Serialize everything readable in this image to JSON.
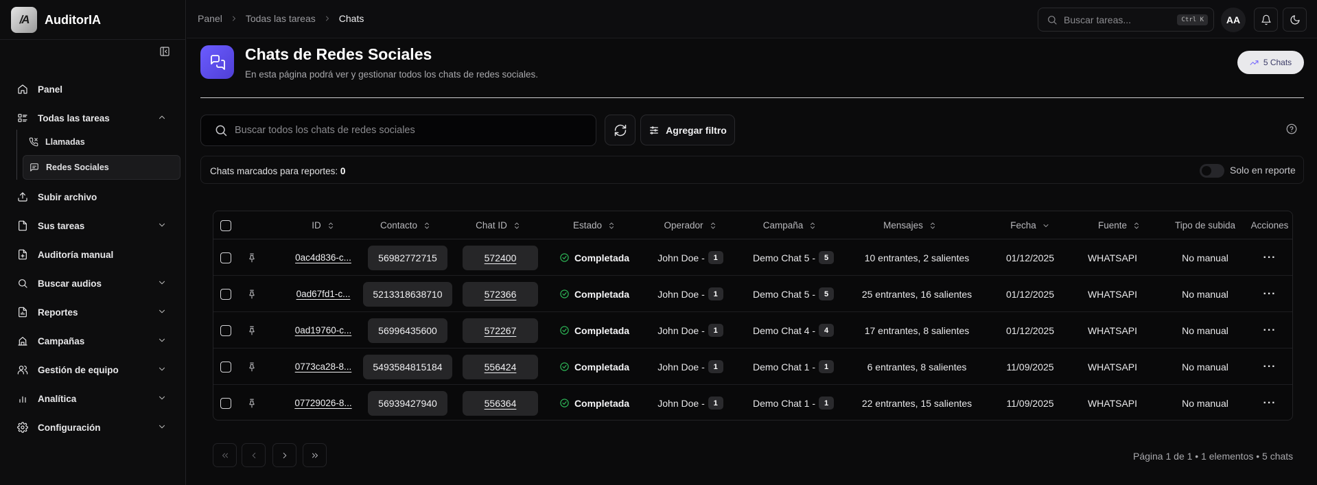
{
  "app": {
    "name": "AuditorIA",
    "logo_text": "/A"
  },
  "sidebar": {
    "items": [
      {
        "label": "Panel",
        "icon": "home-icon"
      },
      {
        "label": "Todas las tareas",
        "icon": "tasks-icon",
        "expanded": true
      },
      {
        "label": "Subir archivo",
        "icon": "upload-icon"
      },
      {
        "label": "Sus tareas",
        "icon": "file-icon"
      },
      {
        "label": "Auditoría manual",
        "icon": "file-plus-icon"
      },
      {
        "label": "Buscar audios",
        "icon": "search-icon"
      },
      {
        "label": "Reportes",
        "icon": "report-icon"
      },
      {
        "label": "Campañas",
        "icon": "campaign-icon"
      },
      {
        "label": "Gestión de equipo",
        "icon": "team-icon"
      },
      {
        "label": "Analítica",
        "icon": "chart-icon"
      },
      {
        "label": "Configuración",
        "icon": "gear-icon"
      }
    ],
    "subitems": [
      {
        "label": "Llamadas",
        "icon": "phone-icon"
      },
      {
        "label": "Redes Sociales",
        "icon": "chat-icon",
        "active": true
      }
    ]
  },
  "header": {
    "breadcrumb": [
      "Panel",
      "Todas las tareas",
      "Chats"
    ],
    "search_placeholder": "Buscar tareas...",
    "shortcut": "Ctrl K",
    "avatar": "AA"
  },
  "page": {
    "title": "Chats de Redes Sociales",
    "subtitle": "En esta página podrá ver y gestionar todos los chats de redes sociales.",
    "count_pill": "5 Chats",
    "search_placeholder": "Buscar todos los chats de redes sociales",
    "filter_label": "Agregar filtro",
    "reported_label": "Chats marcados para reportes:",
    "reported_count": "0",
    "toggle_label": "Solo en reporte"
  },
  "table": {
    "columns": [
      "ID",
      "Contacto",
      "Chat ID",
      "Estado",
      "Operador",
      "Campaña",
      "Mensajes",
      "Fecha",
      "Fuente",
      "Tipo de subida",
      "Acciones"
    ],
    "rows": [
      {
        "id": "0ac4d836-c...",
        "contact": "56982772715",
        "chat_id": "572400",
        "status": "Completada",
        "operator": "John Doe -",
        "operator_n": "1",
        "campaign": "Demo Chat 5 -",
        "campaign_n": "5",
        "messages": "10 entrantes, 2 salientes",
        "date": "01/12/2025",
        "source": "WHATSAPI",
        "upload": "No manual"
      },
      {
        "id": "0ad67fd1-c...",
        "contact": "5213318638710",
        "chat_id": "572366",
        "status": "Completada",
        "operator": "John Doe -",
        "operator_n": "1",
        "campaign": "Demo Chat 5 -",
        "campaign_n": "5",
        "messages": "25 entrantes, 16 salientes",
        "date": "01/12/2025",
        "source": "WHATSAPI",
        "upload": "No manual"
      },
      {
        "id": "0ad19760-c...",
        "contact": "56996435600",
        "chat_id": "572267",
        "status": "Completada",
        "operator": "John Doe -",
        "operator_n": "1",
        "campaign": "Demo Chat 4 -",
        "campaign_n": "4",
        "messages": "17 entrantes, 8 salientes",
        "date": "01/12/2025",
        "source": "WHATSAPI",
        "upload": "No manual"
      },
      {
        "id": "0773ca28-8...",
        "contact": "5493584815184",
        "chat_id": "556424",
        "status": "Completada",
        "operator": "John Doe -",
        "operator_n": "1",
        "campaign": "Demo Chat 1 -",
        "campaign_n": "1",
        "messages": "6 entrantes, 8 salientes",
        "date": "11/09/2025",
        "source": "WHATSAPI",
        "upload": "No manual"
      },
      {
        "id": "07729026-8...",
        "contact": "56939427940",
        "chat_id": "556364",
        "status": "Completada",
        "operator": "John Doe -",
        "operator_n": "1",
        "campaign": "Demo Chat 1 -",
        "campaign_n": "1",
        "messages": "22 entrantes, 15 salientes",
        "date": "11/09/2025",
        "source": "WHATSAPI",
        "upload": "No manual"
      }
    ]
  },
  "pagination": {
    "info": "Página 1 de 1 • 1 elementos • 5 chats"
  },
  "colors": {
    "accent": "#5b4bf0",
    "success": "#2fbf5a",
    "background": "#0b0b0c"
  }
}
